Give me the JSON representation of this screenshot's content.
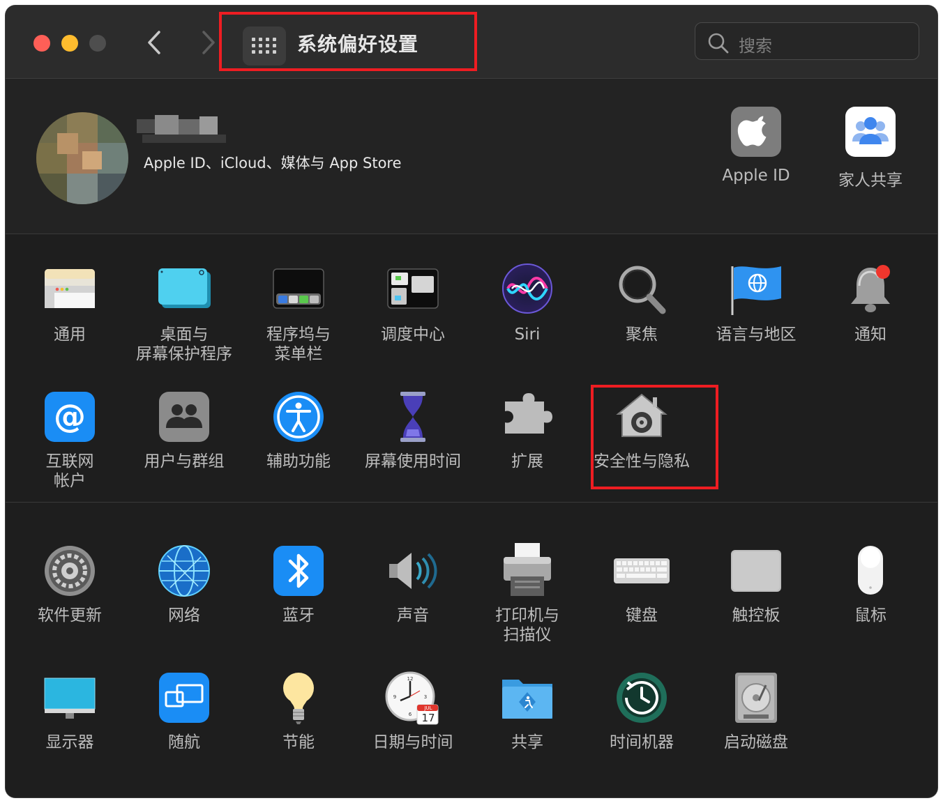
{
  "window": {
    "title": "系统偏好设置",
    "search_placeholder": "搜索"
  },
  "account": {
    "subtitle": "Apple ID、iCloud、媒体与 App Store",
    "items": [
      {
        "label": "Apple ID",
        "icon": "apple-logo-icon"
      },
      {
        "label": "家人共享",
        "icon": "family-sharing-icon"
      }
    ]
  },
  "row1": [
    {
      "label": "通用",
      "icon": "general-icon"
    },
    {
      "label": "桌面与\n屏幕保护程序",
      "icon": "desktop-screensaver-icon"
    },
    {
      "label": "程序坞与\n菜单栏",
      "icon": "dock-menubar-icon"
    },
    {
      "label": "调度中心",
      "icon": "mission-control-icon"
    },
    {
      "label": "Siri",
      "icon": "siri-icon"
    },
    {
      "label": "聚焦",
      "icon": "spotlight-icon"
    },
    {
      "label": "语言与地区",
      "icon": "language-region-icon"
    },
    {
      "label": "通知",
      "icon": "notifications-icon"
    }
  ],
  "row2": [
    {
      "label": "互联网\n帐户",
      "icon": "internet-accounts-icon"
    },
    {
      "label": "用户与群组",
      "icon": "users-groups-icon"
    },
    {
      "label": "辅助功能",
      "icon": "accessibility-icon"
    },
    {
      "label": "屏幕使用时间",
      "icon": "screen-time-icon"
    },
    {
      "label": "扩展",
      "icon": "extensions-icon"
    },
    {
      "label": "安全性与隐私",
      "icon": "security-privacy-icon"
    }
  ],
  "row3": [
    {
      "label": "软件更新",
      "icon": "software-update-icon"
    },
    {
      "label": "网络",
      "icon": "network-icon"
    },
    {
      "label": "蓝牙",
      "icon": "bluetooth-icon"
    },
    {
      "label": "声音",
      "icon": "sound-icon"
    },
    {
      "label": "打印机与\n扫描仪",
      "icon": "printers-scanners-icon"
    },
    {
      "label": "键盘",
      "icon": "keyboard-icon"
    },
    {
      "label": "触控板",
      "icon": "trackpad-icon"
    },
    {
      "label": "鼠标",
      "icon": "mouse-icon"
    }
  ],
  "row4": [
    {
      "label": "显示器",
      "icon": "displays-icon"
    },
    {
      "label": "随航",
      "icon": "sidecar-icon"
    },
    {
      "label": "节能",
      "icon": "energy-saver-icon"
    },
    {
      "label": "日期与时间",
      "icon": "date-time-icon",
      "calendar_month": "JUL",
      "calendar_day": "17"
    },
    {
      "label": "共享",
      "icon": "sharing-icon"
    },
    {
      "label": "时间机器",
      "icon": "time-machine-icon"
    },
    {
      "label": "启动磁盘",
      "icon": "startup-disk-icon"
    }
  ],
  "colors": {
    "highlight_box": "#ee1d22",
    "window_bg": "#1e1e1e",
    "titlebar_bg": "#2c2c2c"
  }
}
